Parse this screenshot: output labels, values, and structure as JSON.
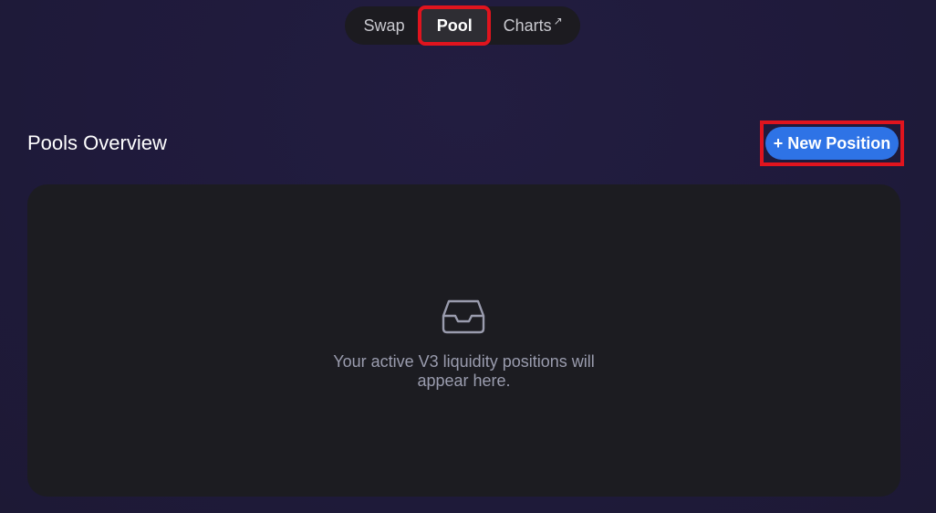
{
  "nav": {
    "tabs": [
      {
        "label": "Swap"
      },
      {
        "label": "Pool"
      },
      {
        "label": "Charts"
      }
    ],
    "charts_ext_icon": "↗"
  },
  "header": {
    "title": "Pools Overview",
    "new_position_label": "+ New Position"
  },
  "panel": {
    "icon": "inbox-icon",
    "empty_line1": "Your active V3 liquidity positions will",
    "empty_line2": "appear here."
  },
  "colors": {
    "background": "#1f1a3b",
    "panel": "#1c1c21",
    "accent": "#2e73e6",
    "highlight": "#e0141e"
  }
}
